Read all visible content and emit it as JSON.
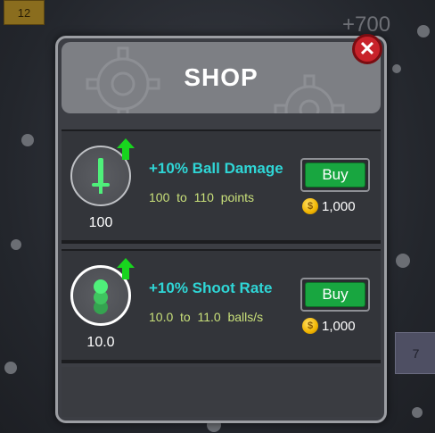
{
  "background": {
    "tile_top_left": "12",
    "tile_right": "7",
    "score_popup": "+700"
  },
  "shop": {
    "title": "SHOP",
    "items": [
      {
        "name": "+10% Ball Damage",
        "level": "100",
        "description": "100  to  110  points",
        "buy_label": "Buy",
        "price": "1,000",
        "icon": "sword-icon"
      },
      {
        "name": "+10% Shoot Rate",
        "level": "10.0",
        "description": "10.0  to  11.0  balls/s",
        "buy_label": "Buy",
        "price": "1,000",
        "icon": "balls-icon"
      }
    ]
  },
  "colors": {
    "accent": "#2fd6d6",
    "buy_button": "#18a640",
    "close_button": "#c8222a",
    "desc_text": "#c9e07a"
  }
}
